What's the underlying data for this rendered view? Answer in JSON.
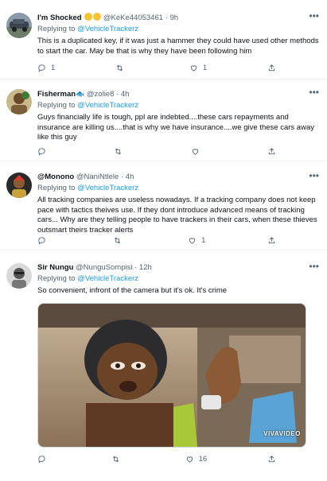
{
  "tweets": [
    {
      "name": "I'm Shocked",
      "name_emojis": [
        "worried-face-emoji",
        "astonished-face-emoji"
      ],
      "handle": "@KeKe44053461",
      "time": "9h",
      "text": "This is a duplicated key, if it was just a hammer they could have used other methods to start the car. May be that is why they have been following him",
      "reply_count": "1",
      "retweet_count": "",
      "like_count": "1"
    },
    {
      "name": "Fisherman",
      "name_emoji": "fish-emoji",
      "handle": "@zolie8",
      "time": "4h",
      "replying_to_label": "Replying to",
      "replying_to_handle": "@VehicleTrackerz",
      "text": "Guys financially life is tough, ppl are indebted....these cars repayments and insurance are killing us....that is why we have insurance....we give these cars away like this guy",
      "reply_count": "",
      "retweet_count": "",
      "like_count": ""
    },
    {
      "name": "@Monono",
      "handle": "@NaniNtlele",
      "time": "4h",
      "replying_to_label": "Replying to",
      "replying_to_handle": "@VehicleTrackerz",
      "text": "All tracking companies are useless nowadays. If a tracking company does not keep pace with tactics theives use. If they dont introduce advanced means of tracking cars... Why are they telling people to have trackers in their cars, when these thieves outsmart theirs tracker alerts",
      "reply_count": "",
      "retweet_count": "",
      "like_count": "1"
    },
    {
      "name": "Sir Nungu",
      "handle": "@NunguSompisi",
      "time": "12h",
      "replying_to_label": "Replying to",
      "replying_to_handle": "@VehicleTrackerz",
      "text": "So convenient, infront of the camera but it's ok. It's crime",
      "media_watermark": "VIVAVIDEO",
      "reply_count": "",
      "retweet_count": "",
      "like_count": "16"
    }
  ],
  "more_icon": "ellipsis-icon",
  "reply_label": "Replying to",
  "reply_handle_0": "@VehicleTrackerz"
}
